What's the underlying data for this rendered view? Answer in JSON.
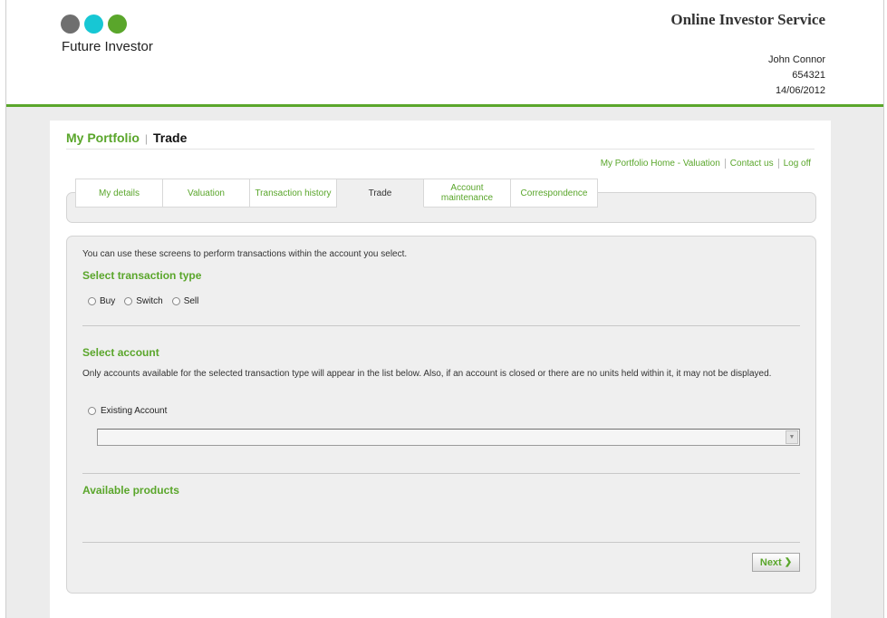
{
  "brand": {
    "name": "Future Investor",
    "dot_colors": [
      "#6f6f6f",
      "#17c7d4",
      "#5aa62b"
    ]
  },
  "header": {
    "service_title": "Online Investor Service",
    "user_name": "John Connor",
    "user_id": "654321",
    "date": "14/06/2012"
  },
  "breadcrumb": {
    "section": "My Portfolio",
    "separator": "|",
    "page": "Trade"
  },
  "toplinks": [
    "My Portfolio Home - Valuation",
    "Contact us",
    "Log off"
  ],
  "tabs": [
    {
      "label": "My details"
    },
    {
      "label": "Valuation"
    },
    {
      "label": "Transaction history"
    },
    {
      "label": "Trade"
    },
    {
      "label": "Account maintenance"
    },
    {
      "label": "Correspondence"
    }
  ],
  "trade": {
    "intro": "You can use these screens to perform transactions within the account you select.",
    "transaction_heading": "Select transaction type",
    "transaction_options": [
      "Buy",
      "Switch",
      "Sell"
    ],
    "account_heading": "Select account",
    "account_note": "Only accounts available for the selected transaction type will appear in the list below. Also, if an account is closed or there are no units held within it, it may not be displayed.",
    "existing_label": "Existing Account",
    "account_select_value": "",
    "products_heading": "Available products",
    "next_label": "Next"
  },
  "colors": {
    "accent": "#5aa62b",
    "panel_bg": "#efefef",
    "page_bg": "#ececec"
  }
}
